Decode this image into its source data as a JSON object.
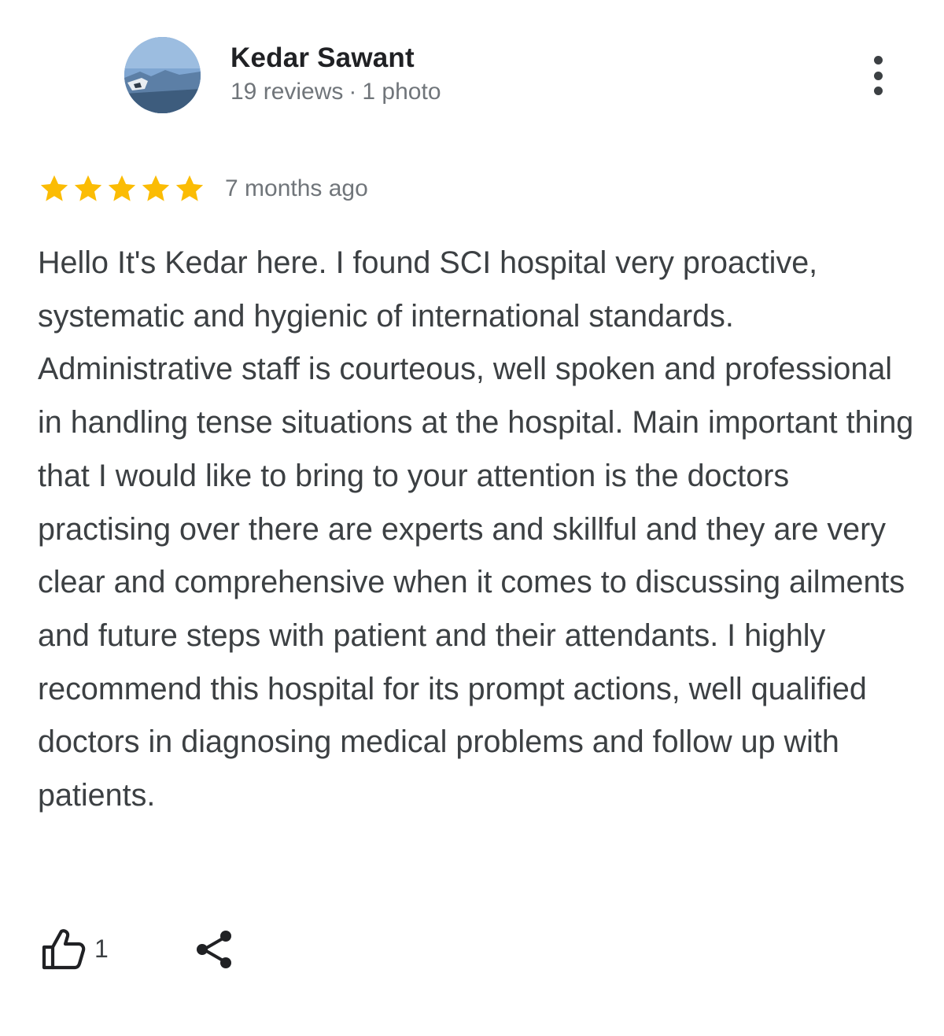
{
  "reviewer": {
    "name": "Kedar Sawant",
    "reviews": "19 reviews",
    "separator": "·",
    "photos": "1 photo",
    "avatar_icon": "profile-photo-avatar"
  },
  "menu": {
    "icon": "more-vert-icon"
  },
  "rating": {
    "stars": 5,
    "max_stars": 5,
    "star_color": "#fbbc04",
    "date": "7 months ago"
  },
  "review": {
    "text": "Hello It's Kedar here. I found SCI hospital very proactive, systematic and hygienic of international standards. Administrative staff is courteous, well spoken and professional in handling tense situations at the hospital. Main important thing that I would like to bring to your attention is the doctors practising over there are experts and skillful and they are very clear and comprehensive when it comes to discussing ailments and future steps with patient and their attendants. I highly recommend this hospital for its prompt actions, well qualified doctors in diagnosing medical problems and follow up with patients."
  },
  "actions": {
    "like_icon": "thumb-up-icon",
    "like_count": "1",
    "share_icon": "share-icon"
  },
  "colors": {
    "text_primary": "#202124",
    "text_body": "#3c4043",
    "text_secondary": "#70757a"
  }
}
